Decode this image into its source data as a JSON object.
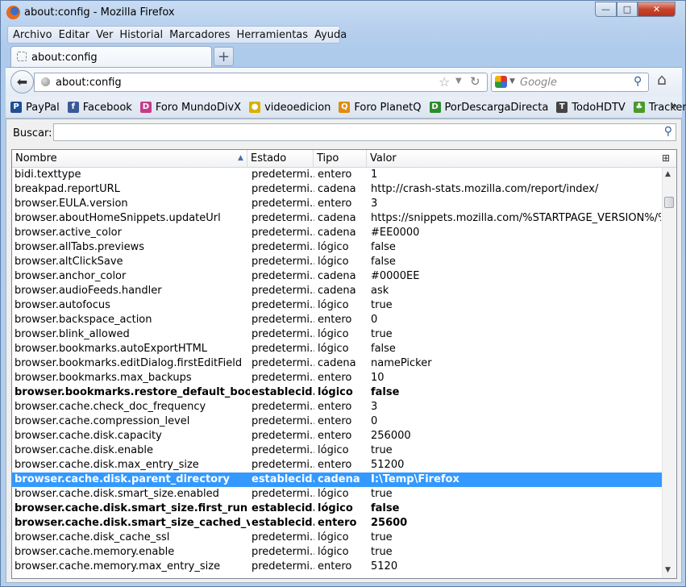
{
  "window": {
    "title": "about:config - Mozilla Firefox",
    "buttons": {
      "minimize": "—",
      "maximize": "□",
      "close": "✕"
    }
  },
  "menubar": [
    "Archivo",
    "Editar",
    "Ver",
    "Historial",
    "Marcadores",
    "Herramientas",
    "Ayuda"
  ],
  "tab": {
    "label": "about:config",
    "new_tab": "+"
  },
  "nav": {
    "url": "about:config",
    "search_placeholder": "Google",
    "icons": {
      "back": "back-arrow-icon",
      "star": "star-icon",
      "reload": "reload-icon",
      "home": "home-icon"
    }
  },
  "bookmarks": [
    {
      "label": "PayPal",
      "icon": "P",
      "color": "#1f4f96"
    },
    {
      "label": "Facebook",
      "icon": "f",
      "color": "#3b5998"
    },
    {
      "label": "Foro MundoDivX",
      "icon": "D",
      "color": "#c63b8a"
    },
    {
      "label": "videoedicion",
      "icon": "●",
      "color": "#d9b000"
    },
    {
      "label": "Foro PlanetQ",
      "icon": "Q",
      "color": "#e08b10"
    },
    {
      "label": "PorDescargaDirecta",
      "icon": "D",
      "color": "#2d8a2d"
    },
    {
      "label": "TodoHDTV",
      "icon": "T",
      "color": "#444444"
    },
    {
      "label": "Trackerhd",
      "icon": "♣",
      "color": "#4a9a2a"
    }
  ],
  "bookmarks_overflow": "»",
  "config": {
    "search_label": "Buscar:",
    "search_value": "",
    "columns": [
      "Nombre",
      "Estado",
      "Tipo",
      "Valor"
    ],
    "rows": [
      {
        "name": "bidi.texttype",
        "state": "predetermi...",
        "type": "entero",
        "value": "1",
        "modified": false
      },
      {
        "name": "breakpad.reportURL",
        "state": "predetermi...",
        "type": "cadena",
        "value": "http://crash-stats.mozilla.com/report/index/",
        "modified": false
      },
      {
        "name": "browser.EULA.version",
        "state": "predetermi...",
        "type": "entero",
        "value": "3",
        "modified": false
      },
      {
        "name": "browser.aboutHomeSnippets.updateUrl",
        "state": "predetermi...",
        "type": "cadena",
        "value": "https://snippets.mozilla.com/%STARTPAGE_VERSION%/%NA...",
        "modified": false
      },
      {
        "name": "browser.active_color",
        "state": "predetermi...",
        "type": "cadena",
        "value": "#EE0000",
        "modified": false
      },
      {
        "name": "browser.allTabs.previews",
        "state": "predetermi...",
        "type": "lógico",
        "value": "false",
        "modified": false
      },
      {
        "name": "browser.altClickSave",
        "state": "predetermi...",
        "type": "lógico",
        "value": "false",
        "modified": false
      },
      {
        "name": "browser.anchor_color",
        "state": "predetermi...",
        "type": "cadena",
        "value": "#0000EE",
        "modified": false
      },
      {
        "name": "browser.audioFeeds.handler",
        "state": "predetermi...",
        "type": "cadena",
        "value": "ask",
        "modified": false
      },
      {
        "name": "browser.autofocus",
        "state": "predetermi...",
        "type": "lógico",
        "value": "true",
        "modified": false
      },
      {
        "name": "browser.backspace_action",
        "state": "predetermi...",
        "type": "entero",
        "value": "0",
        "modified": false
      },
      {
        "name": "browser.blink_allowed",
        "state": "predetermi...",
        "type": "lógico",
        "value": "true",
        "modified": false
      },
      {
        "name": "browser.bookmarks.autoExportHTML",
        "state": "predetermi...",
        "type": "lógico",
        "value": "false",
        "modified": false
      },
      {
        "name": "browser.bookmarks.editDialog.firstEditField",
        "state": "predetermi...",
        "type": "cadena",
        "value": "namePicker",
        "modified": false
      },
      {
        "name": "browser.bookmarks.max_backups",
        "state": "predetermi...",
        "type": "entero",
        "value": "10",
        "modified": false
      },
      {
        "name": "browser.bookmarks.restore_default_bookmarks",
        "state": "establecid...",
        "type": "lógico",
        "value": "false",
        "modified": true
      },
      {
        "name": "browser.cache.check_doc_frequency",
        "state": "predetermi...",
        "type": "entero",
        "value": "3",
        "modified": false
      },
      {
        "name": "browser.cache.compression_level",
        "state": "predetermi...",
        "type": "entero",
        "value": "0",
        "modified": false
      },
      {
        "name": "browser.cache.disk.capacity",
        "state": "predetermi...",
        "type": "entero",
        "value": "256000",
        "modified": false
      },
      {
        "name": "browser.cache.disk.enable",
        "state": "predetermi...",
        "type": "lógico",
        "value": "true",
        "modified": false
      },
      {
        "name": "browser.cache.disk.max_entry_size",
        "state": "predetermi...",
        "type": "entero",
        "value": "51200",
        "modified": false
      },
      {
        "name": "browser.cache.disk.parent_directory",
        "state": "establecid...",
        "type": "cadena",
        "value": "I:\\Temp\\Firefox",
        "modified": true,
        "selected": true
      },
      {
        "name": "browser.cache.disk.smart_size.enabled",
        "state": "predetermi...",
        "type": "lógico",
        "value": "true",
        "modified": false
      },
      {
        "name": "browser.cache.disk.smart_size.first_run",
        "state": "establecid...",
        "type": "lógico",
        "value": "false",
        "modified": true
      },
      {
        "name": "browser.cache.disk.smart_size_cached_value",
        "state": "establecid...",
        "type": "entero",
        "value": "25600",
        "modified": true
      },
      {
        "name": "browser.cache.disk_cache_ssl",
        "state": "predetermi...",
        "type": "lógico",
        "value": "true",
        "modified": false
      },
      {
        "name": "browser.cache.memory.enable",
        "state": "predetermi...",
        "type": "lógico",
        "value": "true",
        "modified": false
      },
      {
        "name": "browser.cache.memory.max_entry_size",
        "state": "predetermi...",
        "type": "entero",
        "value": "5120",
        "modified": false
      }
    ]
  }
}
